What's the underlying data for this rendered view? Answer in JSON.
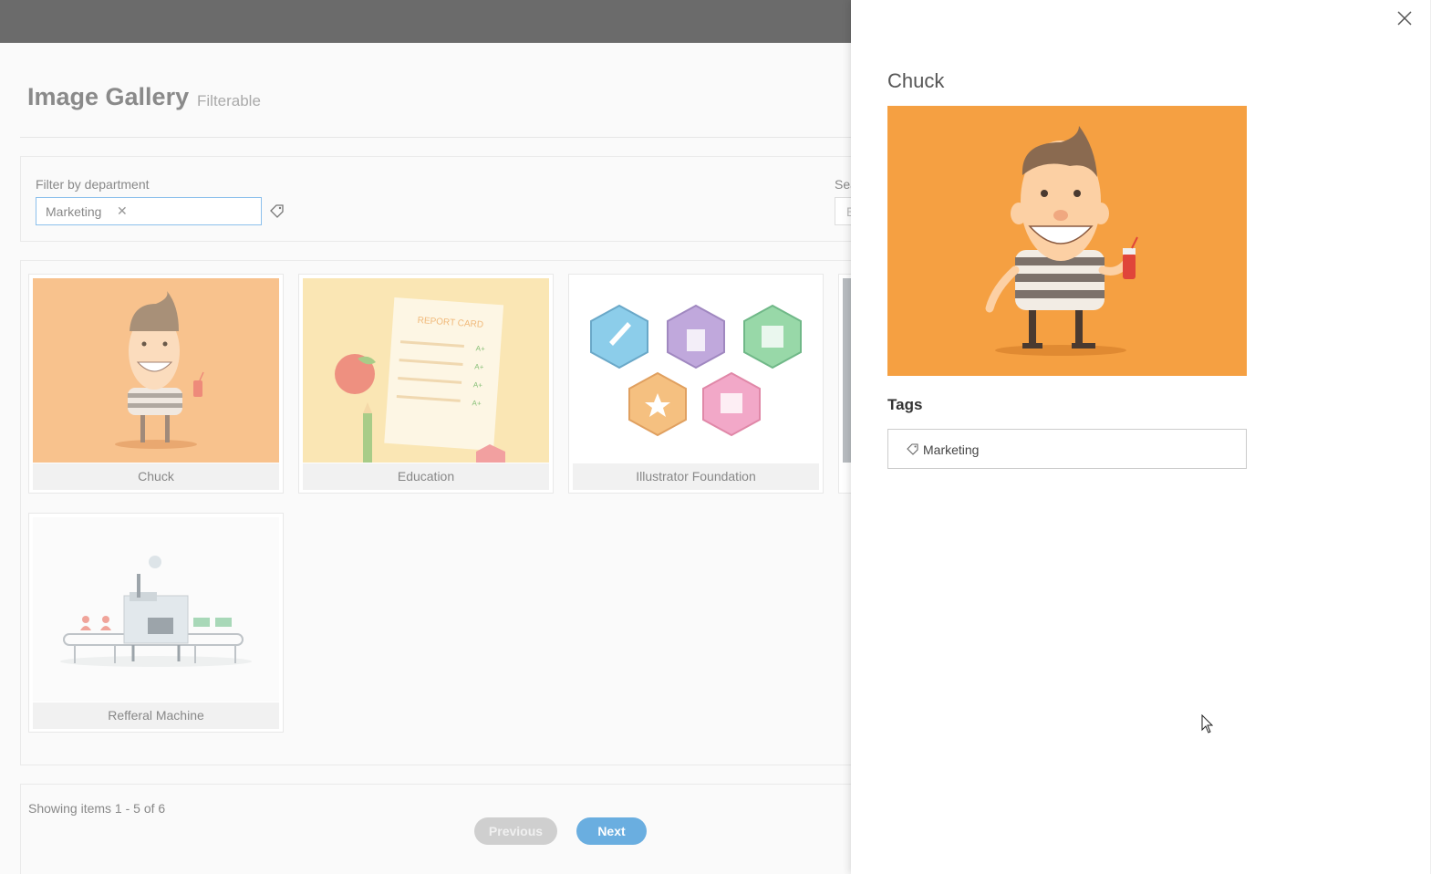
{
  "page": {
    "title": "Image Gallery",
    "subtitle": "Filterable"
  },
  "filter": {
    "label": "Filter by department",
    "chips": [
      {
        "label": "Marketing",
        "remove_icon": "close-icon"
      }
    ],
    "clear_icon": "tag-clear-icon",
    "search_label": "Sea",
    "search_placeholder": "E"
  },
  "gallery": {
    "items": [
      {
        "caption": "Chuck",
        "image": "chuck-character"
      },
      {
        "caption": "Education",
        "image": "report-card"
      },
      {
        "caption": "Illustrator Foundation",
        "image": "hexagon-badges"
      },
      {
        "caption": "Refferal Machine",
        "image": "referral-machine"
      }
    ]
  },
  "pager": {
    "summary": "Showing items 1 - 5 of 6",
    "previous_label": "Previous",
    "next_label": "Next"
  },
  "drawer": {
    "title": "Chuck",
    "tags_heading": "Tags",
    "tags": [
      "Marketing"
    ],
    "close_icon": "close-icon"
  },
  "report_card": {
    "title": "REPORT CARD",
    "grades": [
      "A+",
      "A+",
      "A+",
      "A+"
    ]
  },
  "colors": {
    "topbar": "#6b6b6b",
    "accent": "#6aaee0",
    "chuck_bg": "#f5a042"
  }
}
